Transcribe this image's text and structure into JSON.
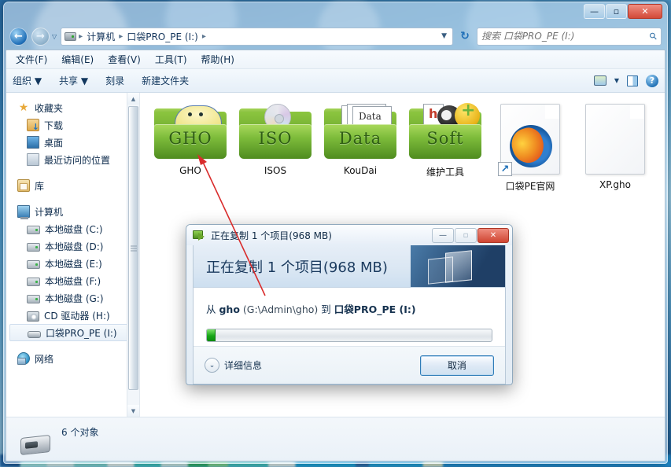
{
  "window": {
    "buttons": {
      "minimize": "—",
      "maximize": "▫",
      "close": "✕"
    }
  },
  "address": {
    "back_icon": "back-arrow-icon",
    "forward_icon": "forward-arrow-icon",
    "recent_caret": "▽",
    "crumbs": [
      "计算机",
      "口袋PRO_PE (I:)"
    ],
    "separator": "▸",
    "dropdown": "▼",
    "refresh": "↻"
  },
  "search": {
    "placeholder": "搜索 口袋PRO_PE (I:)",
    "value": "",
    "icon": "search-icon"
  },
  "menubar": {
    "items": [
      "文件(F)",
      "编辑(E)",
      "查看(V)",
      "工具(T)",
      "帮助(H)"
    ]
  },
  "toolbar": {
    "items": [
      "组织 ▼",
      "共享 ▼",
      "刻录",
      "新建文件夹"
    ],
    "view_caret": "▼",
    "icons": [
      "view-options-icon",
      "preview-pane-icon",
      "help-icon"
    ],
    "help_glyph": "?"
  },
  "sidebar": {
    "items": [
      {
        "label": "收藏夹",
        "icon": "favorites-star-icon",
        "level": 0
      },
      {
        "label": "下载",
        "icon": "downloads-icon",
        "level": 1
      },
      {
        "label": "桌面",
        "icon": "desktop-icon",
        "level": 1
      },
      {
        "label": "最近访问的位置",
        "icon": "recent-places-icon",
        "level": 1
      },
      {
        "label": "库",
        "icon": "libraries-icon",
        "level": 0
      },
      {
        "label": "计算机",
        "icon": "computer-icon",
        "level": 0
      },
      {
        "label": "本地磁盘 (C:)",
        "icon": "hard-drive-icon",
        "level": 1
      },
      {
        "label": "本地磁盘 (D:)",
        "icon": "hard-drive-icon",
        "level": 1
      },
      {
        "label": "本地磁盘 (E:)",
        "icon": "hard-drive-icon",
        "level": 1
      },
      {
        "label": "本地磁盘 (F:)",
        "icon": "hard-drive-icon",
        "level": 1
      },
      {
        "label": "本地磁盘 (G:)",
        "icon": "hard-drive-icon",
        "level": 1
      },
      {
        "label": "CD 驱动器 (H:)",
        "icon": "cd-drive-icon",
        "level": 1
      },
      {
        "label": "口袋PRO_PE (I:)",
        "icon": "usb-drive-icon",
        "level": 1,
        "selected": true
      },
      {
        "label": "网络",
        "icon": "network-icon",
        "level": 0
      }
    ]
  },
  "files": [
    {
      "name": "GHO",
      "icon": "green-folder-gho-icon",
      "folder_text": "GHO"
    },
    {
      "name": "ISOS",
      "icon": "green-folder-iso-icon",
      "folder_text": "ISO"
    },
    {
      "name": "KouDai",
      "icon": "green-folder-data-icon",
      "folder_text": "Data",
      "doc_text": "Data"
    },
    {
      "name": "维护工具",
      "icon": "green-folder-soft-icon",
      "folder_text": "Soft"
    },
    {
      "name": "口袋PE官网",
      "icon": "firefox-shortcut-icon",
      "shortcut_glyph": "↗"
    },
    {
      "name": "XP.gho",
      "icon": "gho-file-icon"
    }
  ],
  "statusbar": {
    "text": "6 个对象",
    "icon": "usb-drive-icon"
  },
  "dialog": {
    "titlebar_text": "正在复制 1 个项目(968 MB)",
    "title_icon": "copy-icon",
    "buttons": {
      "minimize": "—",
      "maximize": "▫",
      "close": "✕"
    },
    "header_text": "正在复制 1 个项目(968 MB)",
    "watermark": "windows-logo-watermark",
    "from_prefix": "从 ",
    "source_name": "gho",
    "source_path": " (G:\\Admin\\gho) ",
    "to_prefix": "到 ",
    "destination": "口袋PRO_PE (I:)",
    "progress_percent": 3,
    "details_label": "详细信息",
    "details_chevron": "⌄",
    "cancel_label": "取消"
  },
  "annotation": {
    "color": "#d92c2c",
    "type": "arrow-pointing-to-gho-folder"
  }
}
